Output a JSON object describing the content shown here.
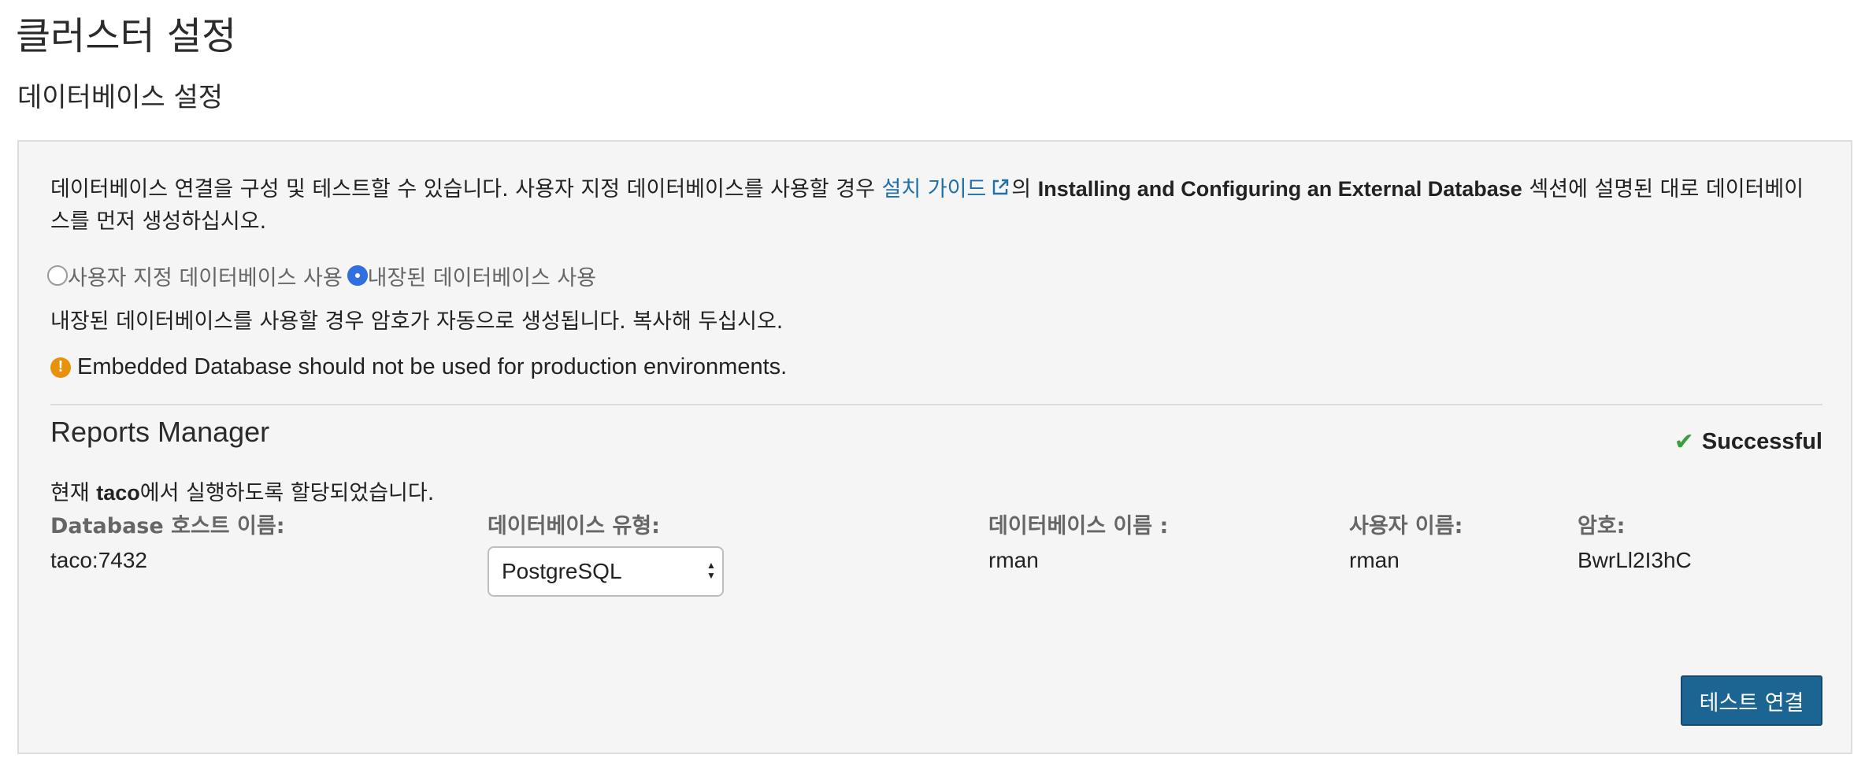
{
  "header": {
    "title": "클러스터 설정",
    "section_title": "데이터베이스 설정"
  },
  "panel": {
    "intro_before_link": "데이터베이스 연결을 구성 및 테스트할 수 있습니다. 사용자 지정 데이터베이스를 사용할 경우 ",
    "install_guide_link": "설치 가이드",
    "intro_particle": "의 ",
    "intro_bold": "Installing and Configuring an External Database",
    "intro_after": " 섹션에 설명된 대로 데이터베이스를 먼저 생성하십시오.",
    "radio_custom_label": "사용자 지정 데이터베이스 사용",
    "radio_embedded_label": "내장된 데이터베이스 사용",
    "selected_radio": "embedded",
    "auto_password_note": "내장된 데이터베이스를 사용할 경우 암호가 자동으로 생성됩니다. 복사해 두십시오.",
    "warning_text": "Embedded Database should not be used for production environments."
  },
  "reports_manager": {
    "title": "Reports Manager",
    "status": "Successful",
    "assigned_prefix": "현재 ",
    "assigned_host": "taco",
    "assigned_suffix": "에서 실행하도록 할당되었습니다.",
    "labels": {
      "host": "Database 호스트 이름:",
      "type": "데이터베이스 유형:",
      "db_name": "데이터베이스 이름 :",
      "user": "사용자 이름:",
      "password": "암호:"
    },
    "values": {
      "host": "taco:7432",
      "type": "PostgreSQL",
      "db_name": "rman",
      "user": "rman",
      "password": "BwrLl2I3hC"
    }
  },
  "actions": {
    "test_connection": "테스트 연결"
  },
  "colors": {
    "link": "#1f6fa8",
    "radio_selected": "#2f6fe0",
    "warning": "#e8920c",
    "success": "#3aa13a",
    "button": "#1c6593"
  },
  "icons": {
    "external_link": "external-link-icon",
    "warning": "exclamation-circle-icon",
    "success": "check-icon",
    "select": "updown-arrows-icon"
  }
}
